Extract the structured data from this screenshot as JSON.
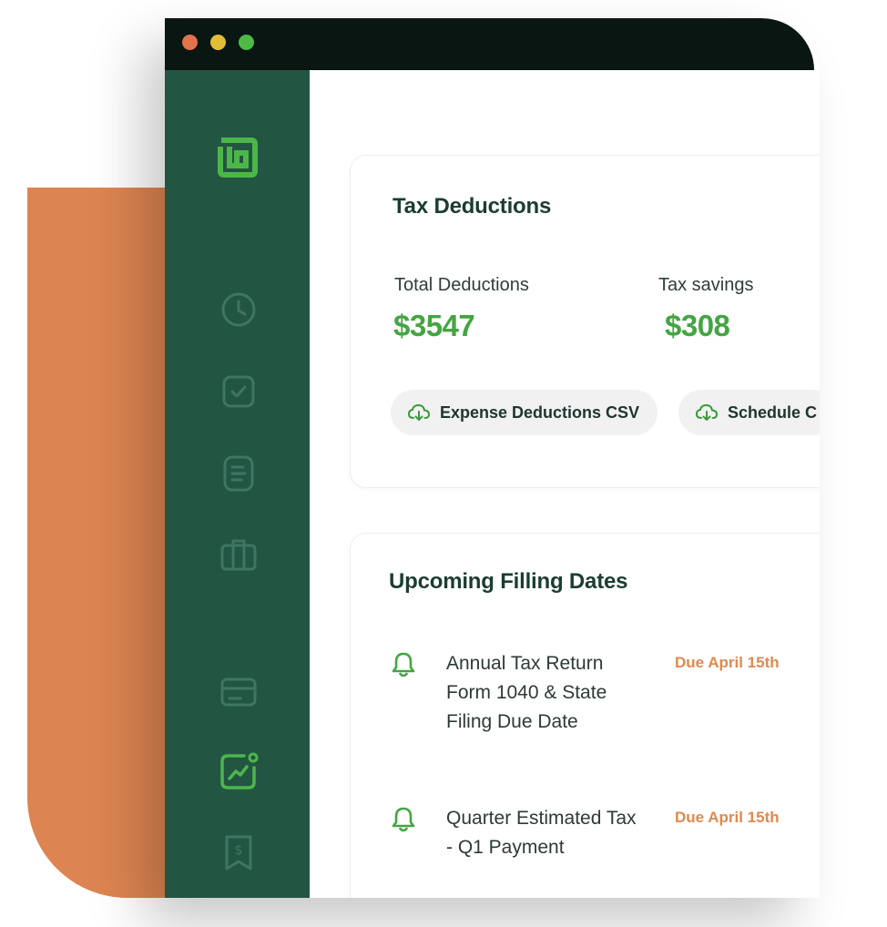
{
  "colors": {
    "accent_green": "#44a542",
    "sidebar_bg": "#235543",
    "titlebar_bg": "#091612",
    "orange_decoration": "#dd8552",
    "due_date_orange": "#e0894f",
    "traffic_red": "#e1734d",
    "traffic_yellow": "#e3bd36",
    "traffic_green": "#4eb945"
  },
  "sidebar": {
    "logo": "app-logo-icon",
    "items": [
      {
        "icon": "clock-icon",
        "active": false
      },
      {
        "icon": "checkbox-icon",
        "active": false
      },
      {
        "icon": "document-icon",
        "active": false
      },
      {
        "icon": "briefcase-icon",
        "active": false
      },
      {
        "icon": "credit-card-icon",
        "active": false
      },
      {
        "icon": "chart-trend-icon",
        "active": true
      },
      {
        "icon": "dollar-bookmark-icon",
        "active": false
      }
    ]
  },
  "deductions": {
    "title": "Tax Deductions",
    "total_label": "Total Deductions",
    "total_value": "$3547",
    "savings_label": "Tax savings",
    "savings_value": "$308",
    "buttons": [
      {
        "label": "Expense Deductions CSV",
        "icon": "cloud-download-icon"
      },
      {
        "label": "Schedule C",
        "icon": "cloud-download-icon"
      }
    ]
  },
  "filings": {
    "title": "Upcoming Filling Dates",
    "items": [
      {
        "icon": "bell-icon",
        "text": "Annual Tax Return Form 1040 & State Filing Due Date",
        "due": "Due April 15th"
      },
      {
        "icon": "bell-icon",
        "text": "Quarter Estimated Tax - Q1 Payment",
        "due": "Due April 15th"
      }
    ]
  }
}
